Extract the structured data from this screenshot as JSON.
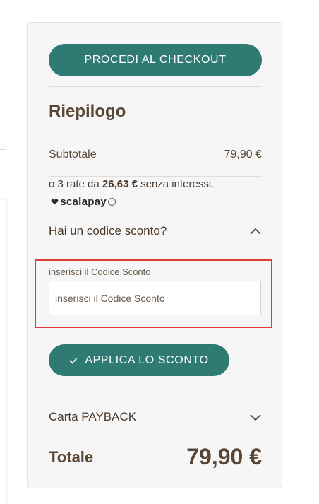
{
  "checkout": {
    "button_label": "PROCEDI AL CHECKOUT"
  },
  "summary": {
    "title": "Riepilogo",
    "subtotal_label": "Subtotale",
    "subtotal_value": "79,90 €",
    "installments": {
      "prefix": "o 3 rate da ",
      "amount": "26,63 €",
      "suffix": " senza interessi."
    },
    "scalapay_brand": "scalapay",
    "info_symbol": "i"
  },
  "discount": {
    "title": "Hai un codice sconto?",
    "field_label": "inserisci il Codice Sconto",
    "placeholder": "inserisci il Codice Sconto",
    "value": "",
    "apply_label": "APPLICA LO SCONTO",
    "expanded": true
  },
  "payback": {
    "title": "Carta PAYBACK",
    "expanded": false
  },
  "total": {
    "label": "Totale",
    "value": "79,90 €"
  },
  "colors": {
    "accent": "#2f7b74",
    "text": "#5a4634",
    "highlight_border": "#e03a36"
  },
  "icons": {
    "heart": "heart-icon",
    "info": "info-icon",
    "chevron_up": "chevron-up-icon",
    "chevron_down": "chevron-down-icon",
    "check": "check-icon"
  }
}
